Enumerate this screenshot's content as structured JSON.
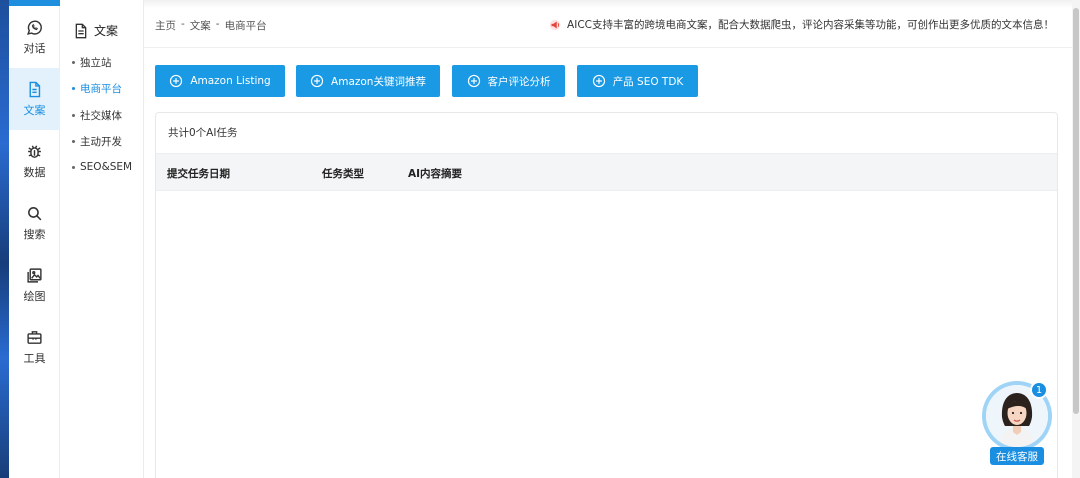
{
  "rail": {
    "items": [
      {
        "label": "对话",
        "icon": "whatsapp-chat-icon"
      },
      {
        "label": "文案",
        "icon": "document-icon",
        "active": true
      },
      {
        "label": "数据",
        "icon": "bug-icon"
      },
      {
        "label": "搜索",
        "icon": "search-icon"
      },
      {
        "label": "绘图",
        "icon": "image-icon"
      },
      {
        "label": "工具",
        "icon": "toolbox-icon"
      }
    ]
  },
  "category": {
    "title": "文案",
    "items": [
      {
        "label": "独立站"
      },
      {
        "label": "电商平台",
        "active": true
      },
      {
        "label": "社交媒体"
      },
      {
        "label": "主动开发"
      },
      {
        "label": "SEO&SEM"
      }
    ]
  },
  "breadcrumb": {
    "items": [
      "主页",
      "-",
      "文案",
      "-",
      "电商平台"
    ]
  },
  "notice": "AICC支持丰富的跨境电商文案，配合大数据爬虫，评论内容采集等功能，可创作出更多优质的文本信息！",
  "actions": [
    {
      "label": "Amazon Listing"
    },
    {
      "label": "Amazon关键词推荐"
    },
    {
      "label": "客户评论分析"
    },
    {
      "label": "产品 SEO TDK"
    }
  ],
  "tasks": {
    "count_text": "共计0个AI任务",
    "columns": [
      "提交任务日期",
      "任务类型",
      "AI内容摘要"
    ],
    "rows": []
  },
  "service": {
    "label": "在线客服",
    "badge": "1"
  },
  "colors": {
    "accent": "#1a9ae4",
    "active_bg": "#e2f1fc"
  }
}
